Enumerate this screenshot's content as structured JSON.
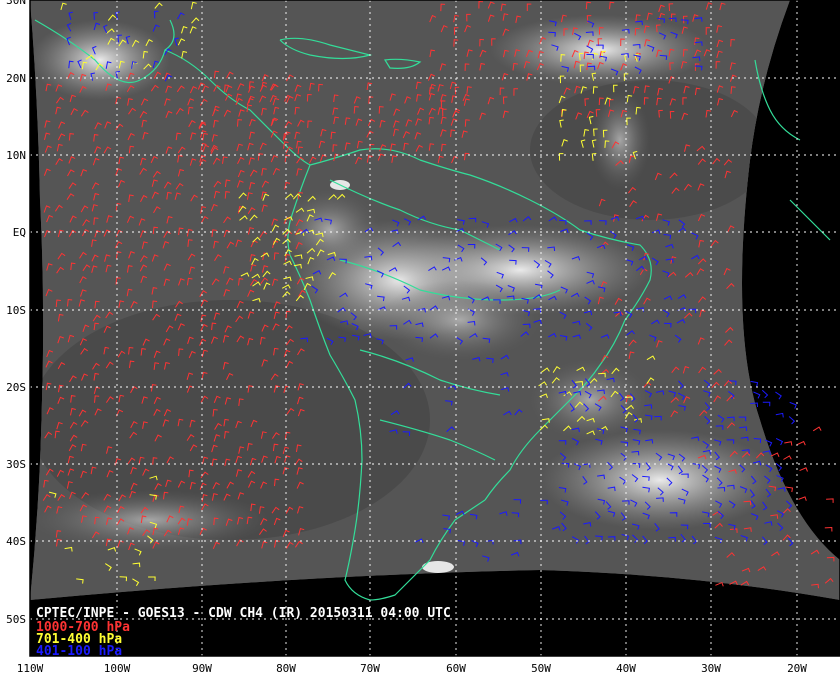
{
  "title": "CPTEC/INPE - GOES13 - CDW CH4 (IR) 20150311 04:00 UTC",
  "legend": [
    {
      "label": "1000-700 hPa",
      "color": "#ff3333"
    },
    {
      "label": "701-400 hPa",
      "color": "#ffff33"
    },
    {
      "label": "401-100 hPa",
      "color": "#1a1aff"
    }
  ],
  "coastline_color": "#33dd99",
  "grid": {
    "lat_labels": [
      "30N",
      "20N",
      "10N",
      "EQ",
      "10S",
      "20S",
      "30S",
      "40S",
      "50S"
    ],
    "lon_labels": [
      "110W",
      "100W",
      "90W",
      "80W",
      "70W",
      "60W",
      "50W",
      "40W",
      "30W",
      "20W"
    ]
  }
}
